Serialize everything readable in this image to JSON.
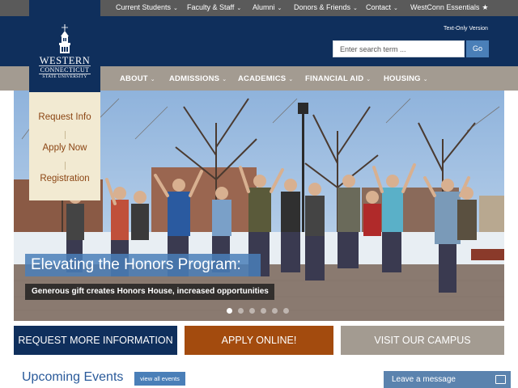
{
  "utility_nav": {
    "items": [
      {
        "label": "Current Students",
        "icon": "chevron-down-icon"
      },
      {
        "label": "Faculty & Staff",
        "icon": "chevron-down-icon"
      },
      {
        "label": "Alumni",
        "icon": "chevron-down-icon"
      },
      {
        "label": "Donors & Friends",
        "icon": "chevron-down-icon"
      },
      {
        "label": "Contact",
        "icon": "chevron-down-icon"
      },
      {
        "label": "WestConn Essentials",
        "icon": "star-icon"
      }
    ]
  },
  "header": {
    "text_only_link": "Text-Only Version",
    "search": {
      "placeholder": "Enter search term ...",
      "value": "",
      "button_label": "Go"
    }
  },
  "logo": {
    "line1": "WESTERN",
    "line2": "CONNECTICUT",
    "line3": "STATE UNIVERSITY",
    "icon": "cupola-icon"
  },
  "main_nav": {
    "items": [
      {
        "label": "ABOUT"
      },
      {
        "label": "ADMISSIONS"
      },
      {
        "label": "ACADEMICS"
      },
      {
        "label": "FINANCIAL AID"
      },
      {
        "label": "HOUSING"
      }
    ]
  },
  "quick_links": [
    "Request Info",
    "Apply Now",
    "Registration"
  ],
  "hero": {
    "title": "Elevating the Honors Program:",
    "subtitle": "Generous gift creates Honors House, increased opportunities",
    "slide_count": 6,
    "active_slide": 1
  },
  "cta_buttons": {
    "info": "REQUEST MORE INFORMATION",
    "apply": "APPLY ONLINE!",
    "visit": "VISIT OUR CAMPUS"
  },
  "events": {
    "title": "Upcoming Events",
    "view_all": "view all events"
  },
  "chat": {
    "label": "Leave a message",
    "icon": "chat-window-icon"
  },
  "colors": {
    "navy": "#0f2f5c",
    "taupe": "#a39b91",
    "rust": "#a34b0e",
    "link_blue": "#4a7fb8",
    "cream": "#f2ead2"
  }
}
